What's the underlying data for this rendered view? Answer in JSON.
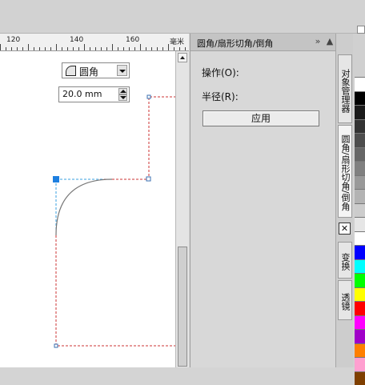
{
  "ruler": {
    "labels": [
      "120",
      "140",
      "160"
    ],
    "unit": "毫米"
  },
  "panel": {
    "title": "圆角/扇形切角/倒角",
    "operation_label": "操作(O):",
    "operation_value": "圆角",
    "radius_label": "半径(R):",
    "radius_value": "20.0 mm",
    "apply_label": "应用",
    "expand_icon": "»",
    "collapse_icon": "▲",
    "close_icon": "×"
  },
  "side_tabs": [
    {
      "label": "对象管理器"
    },
    {
      "label": "圆角/扇形切角/倒角"
    },
    {
      "label": "变换"
    },
    {
      "label": "透镜"
    }
  ],
  "tab_close_icon": "✕",
  "palette": [
    "#ffffff",
    "#000000",
    "#1a1a1a",
    "#333333",
    "#4d4d4d",
    "#666666",
    "#808080",
    "#999999",
    "#b3b3b3",
    "#cccccc",
    "#e6e6e6",
    "#ffffff",
    "#0000ff",
    "#00ffff",
    "#00ff00",
    "#ffff00",
    "#ff0000",
    "#ff00ff",
    "#a000c8",
    "#ff7f00",
    "#ff9fd0",
    "#7f3f00"
  ]
}
